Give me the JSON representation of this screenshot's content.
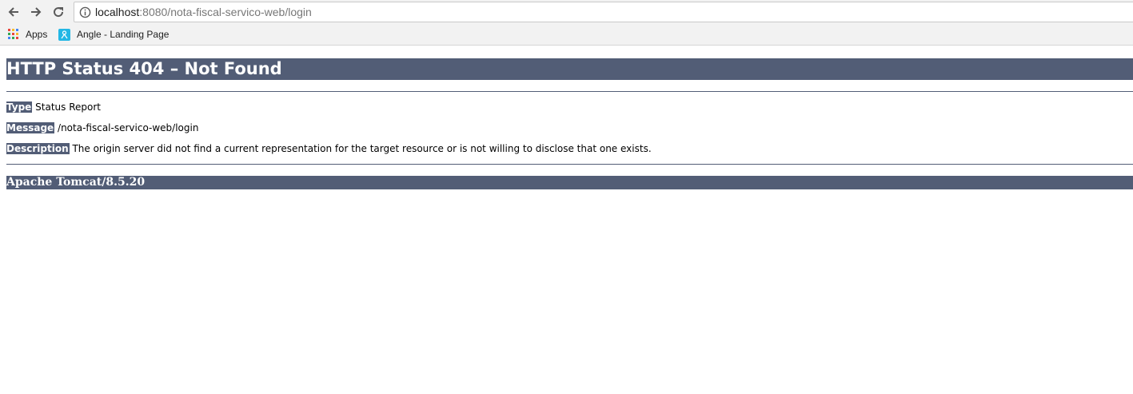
{
  "browser": {
    "back_icon": "arrow-left-icon",
    "forward_icon": "arrow-right-icon",
    "reload_icon": "reload-icon",
    "address": {
      "security_icon": "info-icon",
      "host": "localhost",
      "path": ":8080/nota-fiscal-servico-web/login"
    },
    "bookmarks": [
      {
        "label": "Apps",
        "icon": "apps-grid-icon"
      },
      {
        "label": "Angle - Landing Page",
        "icon": "angle-favicon-icon"
      }
    ]
  },
  "page": {
    "title": "HTTP Status 404 – Not Found",
    "rows": {
      "type": {
        "key": "Type",
        "value": "Status Report"
      },
      "message": {
        "key": "Message",
        "value": "/nota-fiscal-servico-web/login"
      },
      "description": {
        "key": "Description",
        "value": "The origin server did not find a current representation for the target resource or is not willing to disclose that one exists."
      }
    },
    "footer": "Apache Tomcat/8.5.20"
  },
  "colors": {
    "header_bg": "#525d76",
    "header_text": "#ffffff",
    "chrome_bg": "#f2f2f2"
  }
}
